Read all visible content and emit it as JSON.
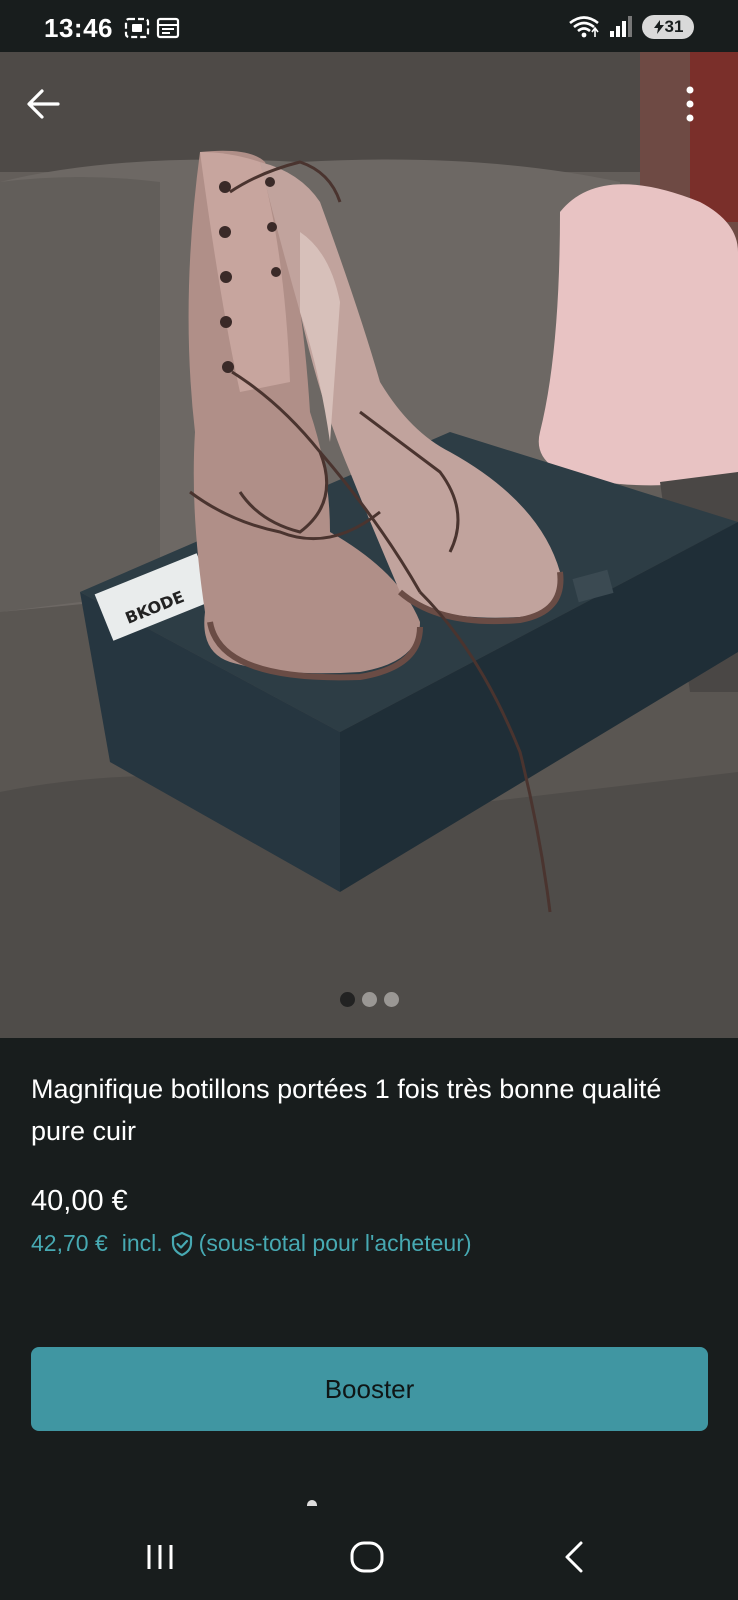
{
  "status_bar": {
    "time": "13:46",
    "battery": "31",
    "icons": [
      "screenshot-icon",
      "calendar-icon",
      "wifi-icon",
      "signal-icon",
      "battery-icon"
    ]
  },
  "photo": {
    "page_count": 3,
    "active_index": 0
  },
  "listing": {
    "title": "Magnifique botillons portées 1 fois très bonne qualité pure cuir",
    "price": "40,00 €",
    "price_incl": "42,70 €",
    "incl_label": "incl.",
    "buyer_subtotal": "(sous-total pour l'acheteur)"
  },
  "actions": {
    "booster_label": "Booster"
  },
  "colors": {
    "background": "#181d1d",
    "accent": "#4096a2",
    "accent_text": "#47a9b2"
  }
}
